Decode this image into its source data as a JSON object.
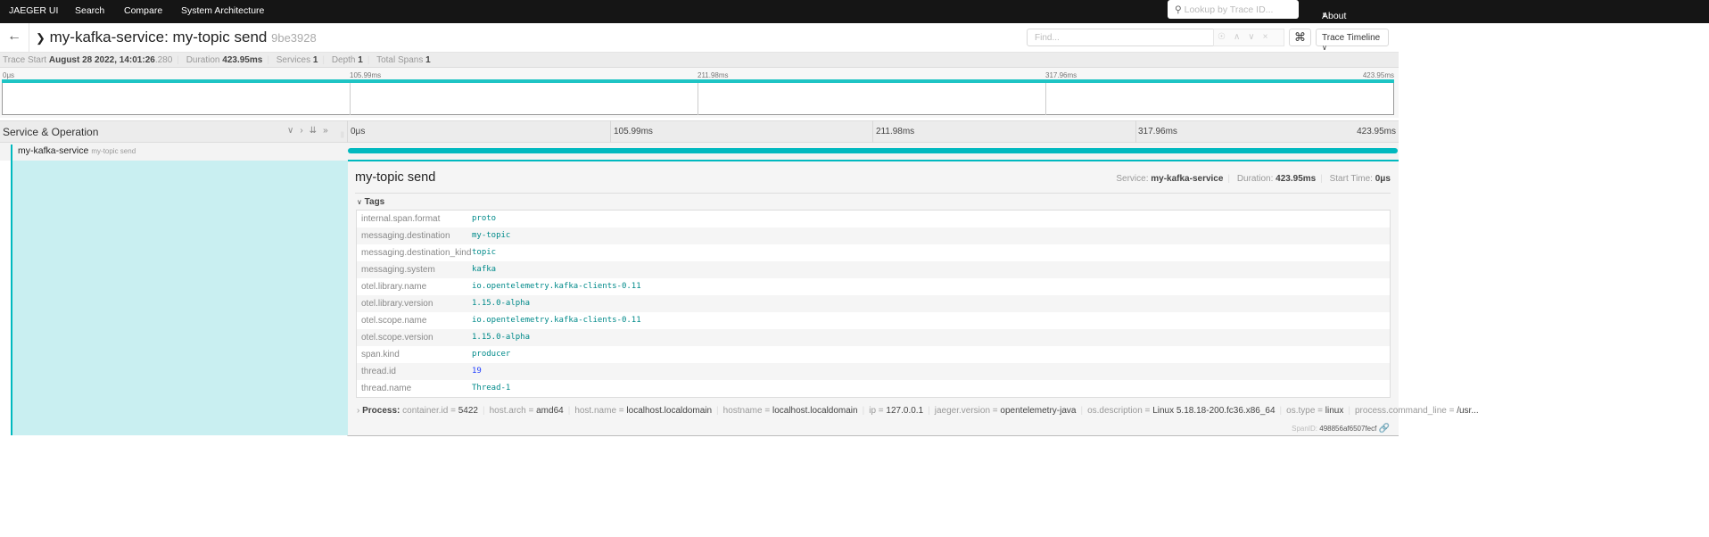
{
  "nav": {
    "brand": "JAEGER UI",
    "items": [
      "Search",
      "Compare",
      "System Architecture"
    ],
    "lookup_placeholder": "Lookup by Trace ID...",
    "about": "About Jaeger"
  },
  "header": {
    "service": "my-kafka-service",
    "operation": "my-topic send",
    "title": "my-kafka-service: my-topic send",
    "trace_id": "9be3928",
    "find_placeholder": "Find...",
    "view": "Trace Timeline"
  },
  "summary": {
    "trace_start_label": "Trace Start",
    "trace_start": "August 28 2022, 14:01:26",
    "trace_start_ms": ".280",
    "duration_label": "Duration",
    "duration": "423.95ms",
    "services_label": "Services",
    "services": "1",
    "depth_label": "Depth",
    "depth": "1",
    "total_spans_label": "Total Spans",
    "total_spans": "1"
  },
  "ticks": [
    "0μs",
    "105.99ms",
    "211.98ms",
    "317.96ms",
    "423.95ms"
  ],
  "colors": {
    "accent": "#00b9bf",
    "nav_bg": "#151515"
  },
  "timeline": {
    "column_title": "Service & Operation",
    "span": {
      "service": "my-kafka-service",
      "operation": "my-topic send",
      "start_fraction": 0,
      "duration_fraction": 1
    }
  },
  "detail": {
    "title": "my-topic send",
    "service_label": "Service:",
    "service": "my-kafka-service",
    "duration_label": "Duration:",
    "duration": "423.95ms",
    "start_label": "Start Time:",
    "start": "0μs",
    "tags_label": "Tags",
    "tags": [
      {
        "k": "internal.span.format",
        "v": "proto"
      },
      {
        "k": "messaging.destination",
        "v": "my-topic"
      },
      {
        "k": "messaging.destination_kind",
        "v": "topic"
      },
      {
        "k": "messaging.system",
        "v": "kafka"
      },
      {
        "k": "otel.library.name",
        "v": "io.opentelemetry.kafka-clients-0.11"
      },
      {
        "k": "otel.library.version",
        "v": "1.15.0-alpha"
      },
      {
        "k": "otel.scope.name",
        "v": "io.opentelemetry.kafka-clients-0.11"
      },
      {
        "k": "otel.scope.version",
        "v": "1.15.0-alpha"
      },
      {
        "k": "span.kind",
        "v": "producer"
      },
      {
        "k": "thread.id",
        "v": "19"
      },
      {
        "k": "thread.name",
        "v": "Thread-1"
      }
    ],
    "process_label": "Process:",
    "process": [
      {
        "k": "container.id",
        "v": "5422"
      },
      {
        "k": "host.arch",
        "v": "amd64"
      },
      {
        "k": "host.name",
        "v": "localhost.localdomain"
      },
      {
        "k": "hostname",
        "v": "localhost.localdomain"
      },
      {
        "k": "ip",
        "v": "127.0.0.1"
      },
      {
        "k": "jaeger.version",
        "v": "opentelemetry-java"
      },
      {
        "k": "os.description",
        "v": "Linux 5.18.18-200.fc36.x86_64"
      },
      {
        "k": "os.type",
        "v": "linux"
      },
      {
        "k": "process.command_line",
        "v": "/usr..."
      }
    ],
    "span_id_label": "SpanID:",
    "span_id": "498856af6507fecf"
  }
}
